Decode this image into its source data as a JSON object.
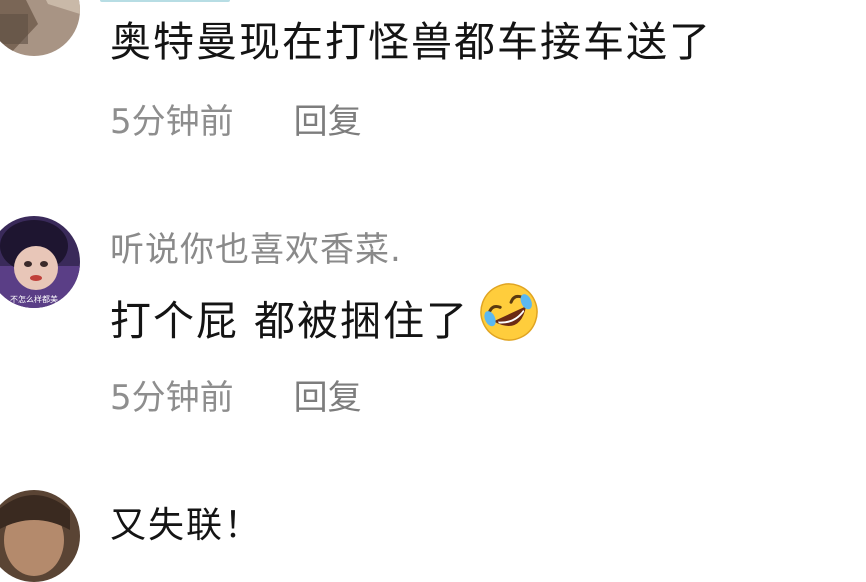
{
  "comments": [
    {
      "text": "奥特曼现在打怪兽都车接车送了",
      "time": "5分钟前",
      "reply": "回复"
    },
    {
      "username": "听说你也喜欢香菜.",
      "text": "打个屁 都被捆住了",
      "emoji": "rolling-on-floor-laughing",
      "avatar_caption": "不怎么样都美",
      "time": "5分钟前",
      "reply": "回复"
    },
    {
      "text": "又失联！"
    }
  ]
}
